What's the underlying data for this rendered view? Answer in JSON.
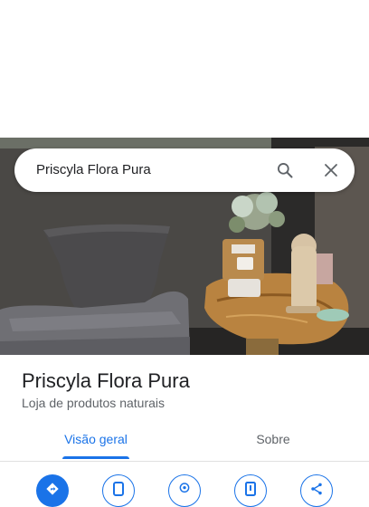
{
  "search": {
    "query": "Priscyla Flora Pura",
    "search_icon": "search-icon",
    "close_icon": "close-icon"
  },
  "place": {
    "name": "Priscyla Flora Pura",
    "category": "Loja de produtos naturais"
  },
  "tabs": [
    {
      "label": "Visão geral",
      "selected": true
    },
    {
      "label": "Sobre",
      "selected": false
    }
  ],
  "actions": [
    {
      "icon": "directions-icon",
      "style": "primary"
    },
    {
      "icon": "phone-icon",
      "style": "outline"
    },
    {
      "icon": "location-pin-icon",
      "style": "outline"
    },
    {
      "icon": "save-icon",
      "style": "outline"
    },
    {
      "icon": "share-icon",
      "style": "outline"
    }
  ],
  "colors": {
    "accent": "#1a73e8",
    "text_primary": "#202124",
    "text_secondary": "#5f6368"
  }
}
